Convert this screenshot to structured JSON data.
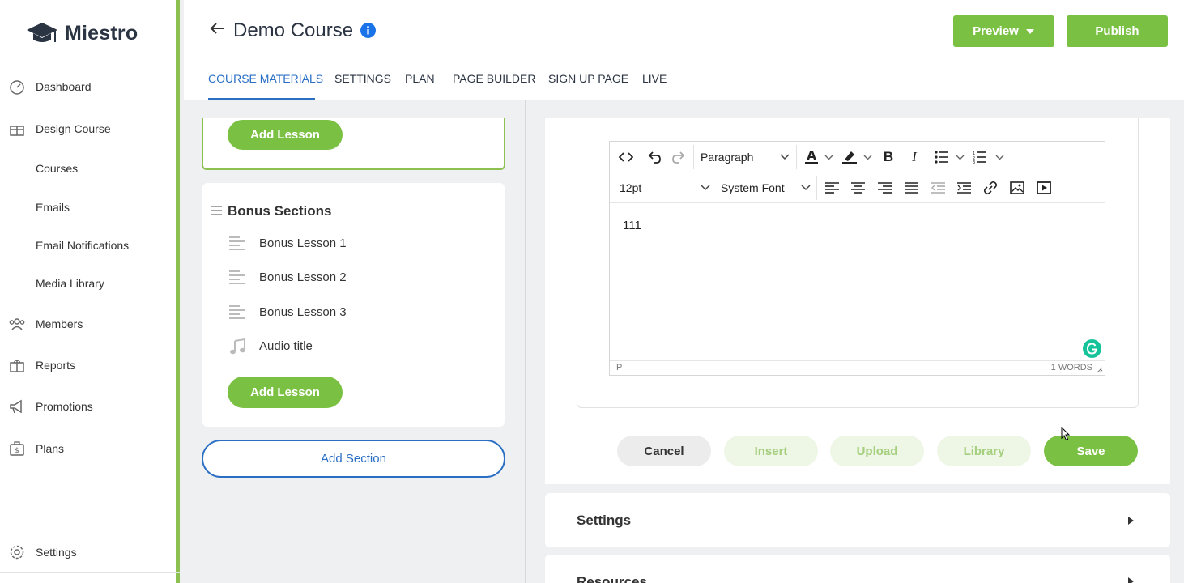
{
  "brand": {
    "name": "Miestro"
  },
  "sidebar": {
    "items": [
      {
        "label": "Dashboard",
        "icon": "dashboard-icon"
      },
      {
        "label": "Design Course",
        "icon": "gift-icon"
      },
      {
        "label": "Courses"
      },
      {
        "label": "Emails"
      },
      {
        "label": "Email Notifications"
      },
      {
        "label": "Media Library"
      },
      {
        "label": "Members",
        "icon": "members-icon"
      },
      {
        "label": "Reports",
        "icon": "reports-icon"
      },
      {
        "label": "Promotions",
        "icon": "megaphone-icon"
      },
      {
        "label": "Plans",
        "icon": "plans-icon"
      },
      {
        "label": "Settings",
        "icon": "gear-icon"
      }
    ]
  },
  "header": {
    "title": "Demo Course",
    "preview_label": "Preview",
    "publish_label": "Publish",
    "tabs": [
      "COURSE MATERIALS",
      "SETTINGS",
      "PLAN",
      "PAGE BUILDER",
      "SIGN UP PAGE",
      "LIVE"
    ],
    "active_tab": "COURSE MATERIALS"
  },
  "left": {
    "add_lesson_label": "Add Lesson",
    "section_title": "Bonus Sections",
    "lessons": [
      {
        "label": "Bonus Lesson 1",
        "icon": "text-lines-icon"
      },
      {
        "label": "Bonus Lesson 2",
        "icon": "text-lines-icon"
      },
      {
        "label": "Bonus Lesson 3",
        "icon": "text-lines-icon"
      },
      {
        "label": "Audio title",
        "icon": "music-note-icon"
      }
    ],
    "add_lesson_label_2": "Add Lesson",
    "add_section_label": "Add Section"
  },
  "editor": {
    "block_format": "Paragraph",
    "font_size": "12pt",
    "font_family": "System Font",
    "content": "111",
    "status_path": "P",
    "word_count": "1 WORDS"
  },
  "actions": {
    "cancel": "Cancel",
    "insert": "Insert",
    "upload": "Upload",
    "library": "Library",
    "save": "Save"
  },
  "panels": {
    "settings": "Settings",
    "resources": "Resources"
  },
  "colors": {
    "accent_green": "#7ac143",
    "light_green": "#eef6e6",
    "link_blue": "#2a6fc4",
    "sidebar_border": "#8cc152"
  }
}
